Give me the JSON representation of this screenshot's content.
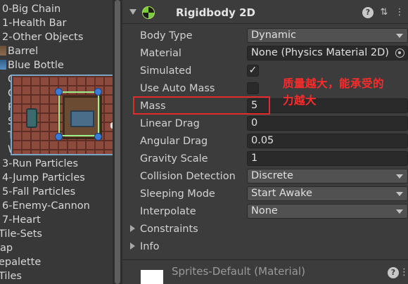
{
  "hierarchy": {
    "items": [
      {
        "label": "0-Big Chain"
      },
      {
        "label": "1-Health Bar"
      },
      {
        "label": "2-Other Objects"
      },
      {
        "label": "Barrel"
      },
      {
        "label": "Blue Bottle"
      },
      {
        "label": "C"
      },
      {
        "label": "C"
      },
      {
        "label": "R"
      },
      {
        "label": "S"
      },
      {
        "label": "T"
      },
      {
        "label": "W"
      },
      {
        "label": "3-Run Particles"
      },
      {
        "label": "4-Jump Particles"
      },
      {
        "label": "5-Fall Particles"
      },
      {
        "label": "6-Enemy-Cannon"
      },
      {
        "label": "7-Heart"
      },
      {
        "label": "Tile-Sets"
      },
      {
        "label": "ap"
      },
      {
        "label": "epalette"
      },
      {
        "label": "Tiles"
      }
    ]
  },
  "component": {
    "title": "Rigidbody 2D",
    "icon": "rigidbody2d-icon",
    "help_icon": "help-icon",
    "preset_icon": "preset-settings-icon",
    "menu_icon": "kebab-menu-icon"
  },
  "properties": {
    "body_type": {
      "label": "Body Type",
      "value": "Dynamic"
    },
    "material": {
      "label": "Material",
      "value": "None (Physics Material 2D)"
    },
    "simulated": {
      "label": "Simulated",
      "checked": true,
      "mark": "✓"
    },
    "use_auto_mass": {
      "label": "Use Auto Mass",
      "checked": false
    },
    "mass": {
      "label": "Mass",
      "value": "5"
    },
    "linear_drag": {
      "label": "Linear Drag",
      "value": "0"
    },
    "angular_drag": {
      "label": "Angular Drag",
      "value": "0.05"
    },
    "gravity_scale": {
      "label": "Gravity Scale",
      "value": "1"
    },
    "collision_detection": {
      "label": "Collision Detection",
      "value": "Discrete"
    },
    "sleeping_mode": {
      "label": "Sleeping Mode",
      "value": "Start Awake"
    },
    "interpolate": {
      "label": "Interpolate",
      "value": "None"
    },
    "constraints": {
      "label": "Constraints"
    },
    "info": {
      "label": "Info"
    }
  },
  "annotation": {
    "text_line1": "质量越大，能承受的",
    "text_line2": "力越大",
    "color": "#ff2a2a"
  },
  "material_footer": {
    "label": "Sprites-Default (Material)"
  },
  "colors": {
    "accent_selection": "#9cf08c",
    "handle": "#3a7bd5",
    "highlight_box": "#e22c2c"
  }
}
